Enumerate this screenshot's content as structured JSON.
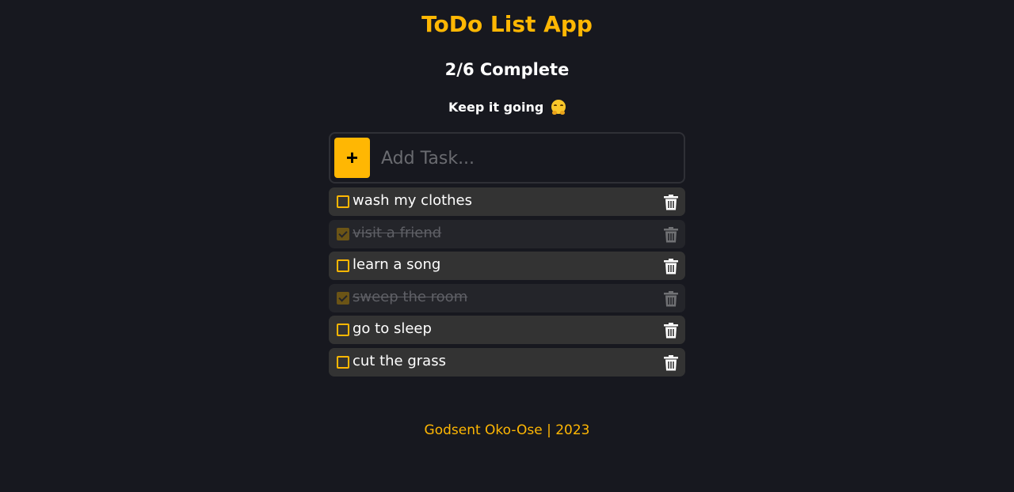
{
  "app": {
    "title": "ToDo List App",
    "progress": "2/6 Complete",
    "completed_count": 2,
    "total_count": 6,
    "motivation": "Keep it going",
    "motivation_emoji": "hugging-face-icon"
  },
  "add_task": {
    "button_label": "+",
    "placeholder": "Add Task..."
  },
  "tasks": [
    {
      "label": "wash my clothes",
      "done": false
    },
    {
      "label": "visit a friend",
      "done": true
    },
    {
      "label": "learn a song",
      "done": false
    },
    {
      "label": "sweep the room",
      "done": true
    },
    {
      "label": "go to sleep",
      "done": false
    },
    {
      "label": "cut the grass",
      "done": false
    }
  ],
  "icons": {
    "delete": "trash-icon",
    "checkbox": "checkbox-icon"
  },
  "footer": {
    "text": "Godsent Oko-Ose | 2023"
  },
  "colors": {
    "accent": "#ffb703",
    "background": "#17181f",
    "task_bg": "#333333",
    "task_done_bg": "#24252a"
  }
}
